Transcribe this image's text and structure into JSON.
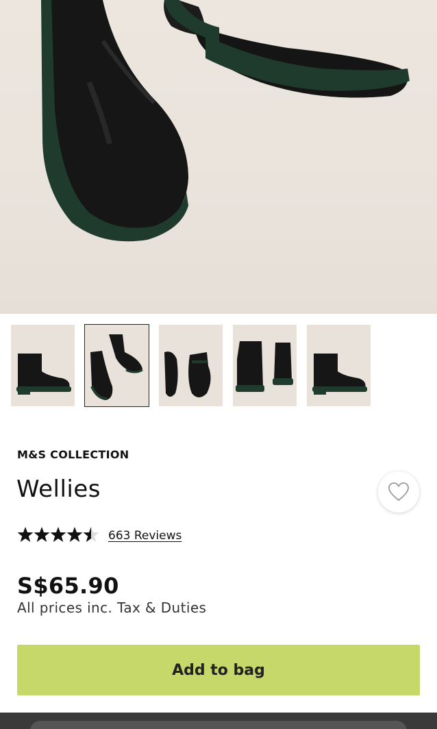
{
  "product": {
    "brand": "M&S COLLECTION",
    "title": "Wellies",
    "rating": 4.5,
    "reviews_label": "663 Reviews",
    "price": "S$65.90",
    "tax_note": "All prices inc. Tax & Duties"
  },
  "gallery": {
    "thumbnails": [
      {
        "label": "side-view"
      },
      {
        "label": "pair-top-view"
      },
      {
        "label": "sole-view"
      },
      {
        "label": "back-view"
      },
      {
        "label": "side-view-2"
      }
    ],
    "selected_index": 1
  },
  "actions": {
    "add_to_bag_label": "Add to bag"
  },
  "icons": {
    "wishlist": "heart-icon",
    "star": "star-icon"
  },
  "colors": {
    "button_bg": "#c5d869",
    "boot": "#1a1a1a",
    "sole": "#1e3a2c",
    "background": "#ebe5de"
  }
}
